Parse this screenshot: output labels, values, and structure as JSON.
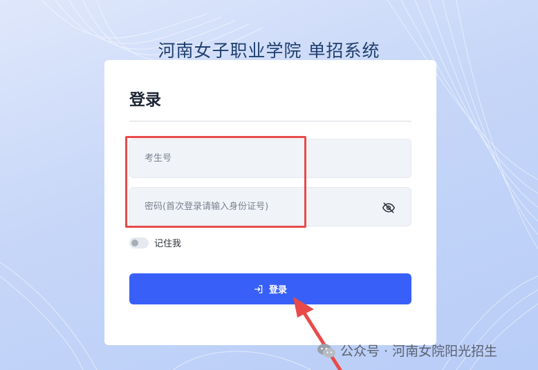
{
  "site": {
    "title": "河南女子职业学院 单招系统"
  },
  "login": {
    "heading": "登录",
    "username_placeholder": "考生号",
    "password_placeholder": "密码(首次登录请输入身份证号)",
    "remember_label": "记住我",
    "submit_label": "登录"
  },
  "watermark": {
    "text": "公众号 · 河南女院阳光招生"
  },
  "icons": {
    "eye": "eye-slash-icon",
    "login": "sign-in-icon",
    "wechat": "wechat-icon"
  },
  "colors": {
    "accent": "#3860f8",
    "highlight": "#e84a4a",
    "title": "#1f3f6e"
  }
}
